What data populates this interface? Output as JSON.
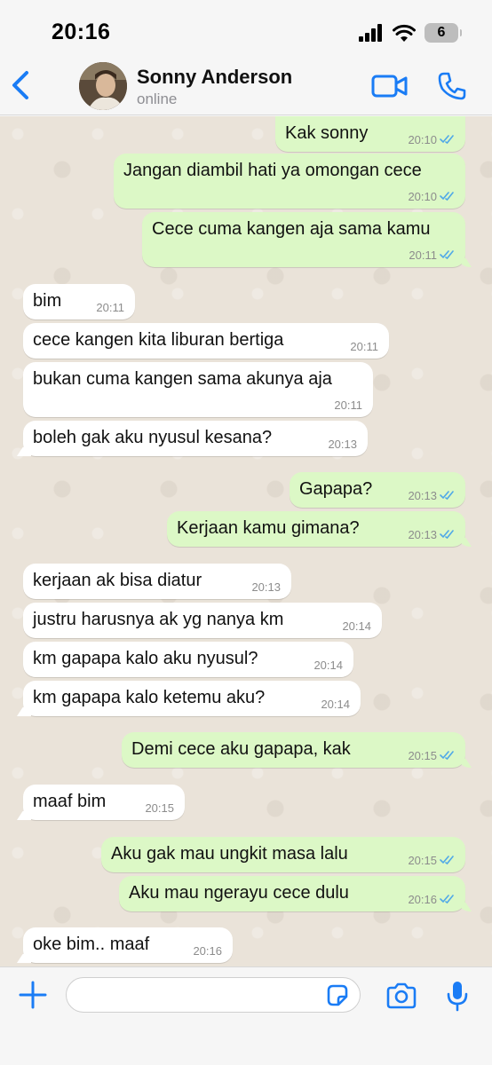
{
  "status_bar": {
    "time": "20:16",
    "battery": "6"
  },
  "header": {
    "contact_name": "Sonny Anderson",
    "status": "online"
  },
  "messages": [
    {
      "dir": "out",
      "text": "Kak sonny",
      "time": "20:10"
    },
    {
      "dir": "out",
      "text": "Jangan diambil hati ya omongan cece",
      "time": "20:10"
    },
    {
      "dir": "out",
      "text": "Cece cuma kangen aja sama kamu",
      "time": "20:11"
    },
    {
      "dir": "in",
      "text": "bim",
      "time": "20:11"
    },
    {
      "dir": "in",
      "text": "cece kangen kita liburan bertiga",
      "time": "20:11"
    },
    {
      "dir": "in",
      "text": "bukan cuma kangen sama akunya aja",
      "time": "20:11"
    },
    {
      "dir": "in",
      "text": "boleh gak aku nyusul kesana?",
      "time": "20:13"
    },
    {
      "dir": "out",
      "text": "Gapapa?",
      "time": "20:13"
    },
    {
      "dir": "out",
      "text": "Kerjaan kamu gimana?",
      "time": "20:13"
    },
    {
      "dir": "in",
      "text": "kerjaan ak bisa diatur",
      "time": "20:13"
    },
    {
      "dir": "in",
      "text": "justru harusnya ak yg nanya km",
      "time": "20:14"
    },
    {
      "dir": "in",
      "text": "km gapapa kalo aku nyusul?",
      "time": "20:14"
    },
    {
      "dir": "in",
      "text": "km gapapa kalo ketemu aku?",
      "time": "20:14"
    },
    {
      "dir": "out",
      "text": "Demi cece aku gapapa, kak",
      "time": "20:15"
    },
    {
      "dir": "in",
      "text": "maaf bim",
      "time": "20:15"
    },
    {
      "dir": "out",
      "text": "Aku gak mau ungkit masa lalu",
      "time": "20:15"
    },
    {
      "dir": "out",
      "text": "Aku mau ngerayu cece dulu",
      "time": "20:16"
    },
    {
      "dir": "in",
      "text": "oke bim.. maaf",
      "time": "20:16"
    }
  ],
  "input": {
    "placeholder": ""
  },
  "colors": {
    "accent": "#1a7cf5",
    "outgoing_bubble": "#dcf8c6",
    "incoming_bubble": "#ffffff",
    "read_ticks": "#4fa8e8",
    "chat_background": "#eae3d9"
  }
}
